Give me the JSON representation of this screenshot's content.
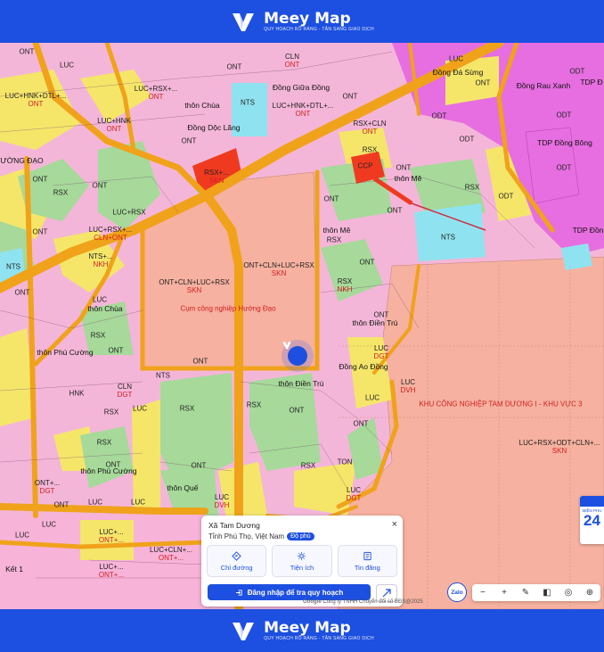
{
  "brand": {
    "name": "Meey Map",
    "tagline": "QUY HOẠCH RÕ RÀNG - TẦN SANG GIAO DỊCH",
    "accent": "#1d4fe0"
  },
  "map": {
    "zone_labels": [
      {
        "code": "ONT",
        "code2": ""
      },
      {
        "code": "LUC",
        "code2": ""
      },
      {
        "code": "CLN",
        "code2": "ONT"
      },
      {
        "code": "ONT",
        "code2": ""
      },
      {
        "code": "LUC",
        "code2": ""
      },
      {
        "code": "ONT",
        "code2": ""
      },
      {
        "code": "ONT",
        "code2": ""
      },
      {
        "code": "ODT",
        "code2": ""
      },
      {
        "code": "LUC+HNK+DTL+...",
        "code2": "ONT"
      },
      {
        "code": "LUC+RSX+...",
        "code2": "ONT"
      },
      {
        "code": "NTS",
        "code2": ""
      },
      {
        "code": "LUC+HNK+DTL+...",
        "code2": "ONT"
      },
      {
        "code": "LUC+HNK",
        "code2": "ONT"
      },
      {
        "code": "RSX+CLN",
        "code2": "ONT"
      },
      {
        "code": "ODT",
        "code2": ""
      },
      {
        "code": "ODT",
        "code2": ""
      },
      {
        "code": "ODT",
        "code2": ""
      },
      {
        "code": "RSX+...",
        "code2": "SKN"
      },
      {
        "code": "CCP",
        "code2": ""
      },
      {
        "code": "ONT",
        "code2": ""
      },
      {
        "code": "RSX",
        "code2": ""
      },
      {
        "code": "ONT",
        "code2": ""
      },
      {
        "code": "ODT",
        "code2": ""
      },
      {
        "code": "ODT",
        "code2": ""
      },
      {
        "code": "RSX",
        "code2": ""
      },
      {
        "code": "ONT",
        "code2": ""
      },
      {
        "code": "ONT",
        "code2": ""
      },
      {
        "code": "LUC+RSX",
        "code2": ""
      },
      {
        "code": "RSX",
        "code2": ""
      },
      {
        "code": "ONT",
        "code2": ""
      },
      {
        "code": "ONT",
        "code2": ""
      },
      {
        "code": "NTS",
        "code2": ""
      },
      {
        "code": "ONT",
        "code2": ""
      },
      {
        "code": "LUC+RSX+...",
        "code2": "CLN+ONT"
      },
      {
        "code": "ONT+CLN+LUC+RSX",
        "code2": "SKN"
      },
      {
        "code": "ONT+CLN+LUC+RSX",
        "code2": "SKN"
      },
      {
        "code": "NTS+...",
        "code2": "NKH"
      },
      {
        "code": "RSX",
        "code2": ""
      },
      {
        "code": "RSX",
        "code2": "NKH"
      },
      {
        "code": "ONT",
        "code2": ""
      },
      {
        "code": "NTS",
        "code2": ""
      },
      {
        "code": "ONT",
        "code2": ""
      },
      {
        "code": "LUC",
        "code2": ""
      },
      {
        "code": "ONT",
        "code2": ""
      },
      {
        "code": "RSX",
        "code2": ""
      },
      {
        "code": "ONT",
        "code2": ""
      },
      {
        "code": "LUC",
        "code2": "DGT"
      },
      {
        "code": "NTS",
        "code2": ""
      },
      {
        "code": "ONT",
        "code2": ""
      },
      {
        "code": "LUC",
        "code2": "DVH"
      },
      {
        "code": "CLN",
        "code2": "DGT"
      },
      {
        "code": "HNK",
        "code2": ""
      },
      {
        "code": "LUC",
        "code2": ""
      },
      {
        "code": "RSX",
        "code2": ""
      },
      {
        "code": "RSX",
        "code2": ""
      },
      {
        "code": "ONT",
        "code2": ""
      },
      {
        "code": "RSX",
        "code2": ""
      },
      {
        "code": "LUC",
        "code2": ""
      },
      {
        "code": "RSX",
        "code2": ""
      },
      {
        "code": "ONT",
        "code2": ""
      },
      {
        "code": "ONT",
        "code2": ""
      },
      {
        "code": "LUC",
        "code2": "DVH"
      },
      {
        "code": "ONT",
        "code2": ""
      },
      {
        "code": "LUC",
        "code2": "DGT"
      },
      {
        "code": "RSX",
        "code2": ""
      },
      {
        "code": "TON",
        "code2": ""
      },
      {
        "code": "ONT+...",
        "code2": "DGT"
      },
      {
        "code": "LUC",
        "code2": ""
      },
      {
        "code": "ONT",
        "code2": ""
      },
      {
        "code": "LUC",
        "code2": ""
      },
      {
        "code": "LUC",
        "code2": ""
      },
      {
        "code": "LUC+...",
        "code2": "ONT+..."
      },
      {
        "code": "LUC+CLN+...",
        "code2": "ONT+..."
      },
      {
        "code": "LUC+...",
        "code2": "ONT+..."
      },
      {
        "code": "LUC",
        "code2": ""
      },
      {
        "code": "LUC+RSX+ODT+CLN+...",
        "code2": "SKN"
      }
    ],
    "place_labels": [
      "Đồng Giữa Đồng",
      "thôn Chùa",
      "Đồng Dộc Lăng",
      "TƯỜNG ĐẠO",
      "thôn Mê",
      "thôn Mê",
      "thôn Chùa",
      "thôn Phú Cường",
      "thôn Điền Trù",
      "thôn Điền Trù",
      "thôn Phú Cường",
      "thôn Quế",
      "Đồng Ao Đồng",
      "Đồng Rau Xanh",
      "Đồng Đá Sừng",
      "TDP Đồng Bông",
      "TDP Đồn",
      "TDP Đ",
      "Kết 1"
    ],
    "red_labels": [
      "Cụm công nghiệp Hướng Đạo",
      "KHU CÔNG NGHIỆP TAM DƯƠNG I - KHU VỰC 3"
    ],
    "colors": {
      "residential_pink": "#f7b3d8",
      "agri_yellow": "#f5e66a",
      "forest_green": "#a6d99a",
      "industrial_salmon": "#f6b1a0",
      "road_orange": "#f0a21a",
      "water_cyan": "#8fe3f0",
      "urban_magenta": "#e66ee0",
      "public_red": "#f03a20"
    }
  },
  "info_card": {
    "title": "Xã Tam Dương",
    "subtitle": "Tỉnh Phú Thọ, Việt Nam",
    "badge": "Độ phủ",
    "actions": [
      {
        "label": "Chỉ đường",
        "icon": "directions-icon"
      },
      {
        "label": "Tiện ích",
        "icon": "amenities-icon"
      },
      {
        "label": "Tin đăng",
        "icon": "listing-icon"
      }
    ],
    "login_button": "Đăng nhập để tra quy hoạch",
    "close": "×"
  },
  "controls": {
    "zalo": "Zalo",
    "zoom_out": "−",
    "zoom_in": "+",
    "attribution": "Công ty TNHH Chuyển đổi số BĐS@2025",
    "google": "Google",
    "side_card_label": "MIỀN PHÚ",
    "side_card_num": "24"
  }
}
